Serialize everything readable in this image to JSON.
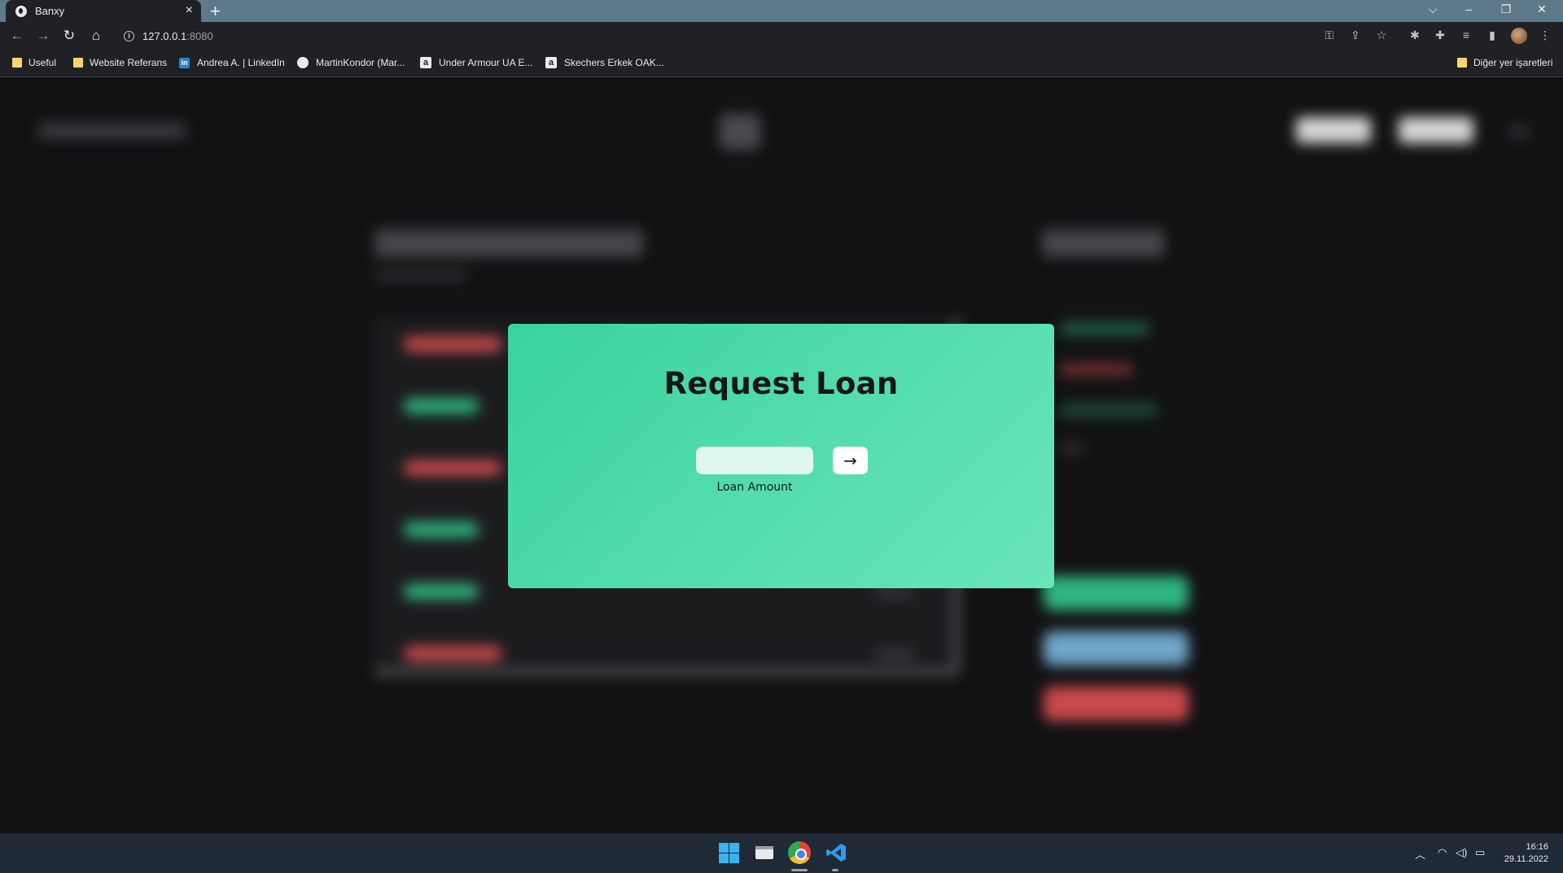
{
  "browser": {
    "tab_title": "Banxy",
    "tab_close": "×",
    "new_tab": "+",
    "url_host": "127.0.0.1",
    "url_port": ":8080",
    "info_icon": "i",
    "window_controls": {
      "tabsearch": "⌵",
      "minimize": "–",
      "restore": "❐",
      "close": "✕"
    },
    "nav": {
      "back": "←",
      "forward": "→",
      "reload": "↻",
      "home": "⌂"
    },
    "toolbar_icons": [
      "key-icon",
      "share-icon",
      "star-icon",
      "extension-gear-icon",
      "puzzle-icon",
      "media-icon",
      "sidepanel-icon",
      "avatar",
      "menu-icon"
    ]
  },
  "bookmarks": [
    {
      "label": "Useful",
      "icon": "folder-icon"
    },
    {
      "label": "Website Referans",
      "icon": "folder-icon"
    },
    {
      "label": "Andrea A. | LinkedIn",
      "icon": "linkedin-icon"
    },
    {
      "label": "MartinKondor (Mar...",
      "icon": "github-icon"
    },
    {
      "label": "Under Armour UA E...",
      "icon": "amazon-icon"
    },
    {
      "label": "Skechers Erkek OAK...",
      "icon": "amazon-icon"
    }
  ],
  "other_bookmarks": "Diğer yer işaretleri",
  "modal": {
    "title": "Request Loan",
    "input_value": "",
    "submit_label": "→",
    "input_label": "Loan Amount"
  },
  "taskbar": {
    "apps": [
      "windows-start-icon",
      "file-explorer-icon",
      "chrome-icon",
      "vscode-icon"
    ],
    "time": "16:16",
    "date": "29.11.2022"
  },
  "colors": {
    "modal_gradient_start": "#39d39e",
    "modal_gradient_end": "#6ae5bb",
    "page_bg": "#121214",
    "deposit_green": "#2fb57f",
    "withdraw_red": "#c94a4a",
    "transfer_blue": "#6fa6c9"
  }
}
